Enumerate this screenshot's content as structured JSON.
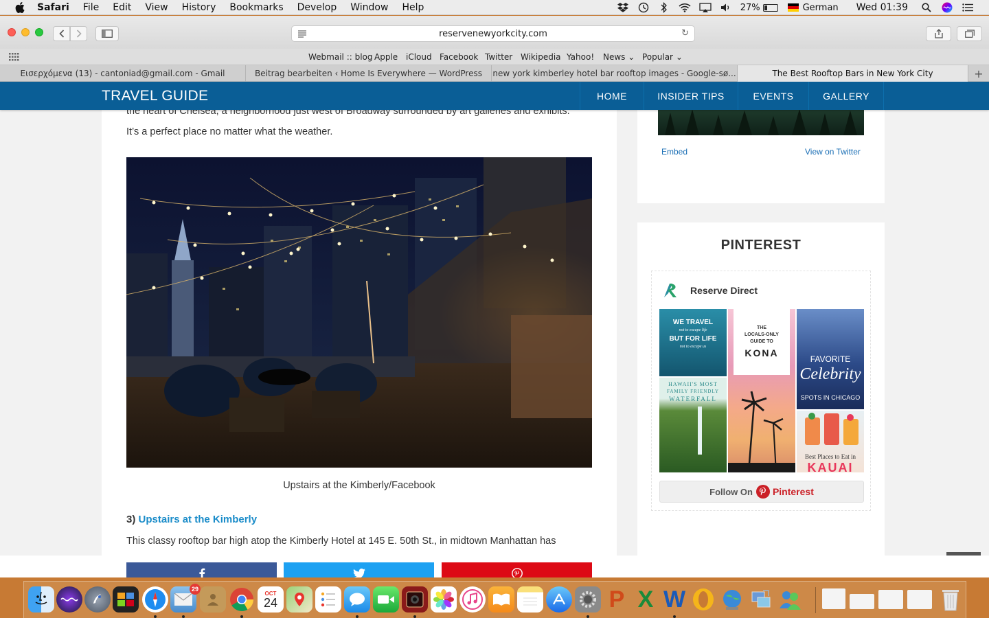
{
  "menubar": {
    "app": "Safari",
    "items": [
      "File",
      "Edit",
      "View",
      "History",
      "Bookmarks",
      "Develop",
      "Window",
      "Help"
    ],
    "battery": "27%",
    "battery_level": 0.27,
    "language": "German",
    "clock": "Wed 01:39"
  },
  "browser": {
    "url": "reservenewyorkcity.com",
    "favorites": [
      "Webmail :: blog",
      "Apple",
      "iCloud",
      "Facebook",
      "Twitter",
      "Wikipedia",
      "Yahoo!",
      "News",
      "Popular"
    ],
    "tabs": [
      "Εισερχόμενα (13) - cantoniad@gmail.com - Gmail",
      "Beitrag bearbeiten ‹ Home Is Everywhere — WordPress",
      "new york kimberley hotel bar rooftop images - Google-sø...",
      "The Best Rooftop Bars in New York City"
    ],
    "active_tab": 3
  },
  "site": {
    "brand": "TRAVEL GUIDE",
    "nav": [
      "HOME",
      "INSIDER TIPS",
      "EVENTS",
      "GALLERY"
    ],
    "article": {
      "para1": "the heart of Chelsea, a neighborhood just west of Broadway surrounded by art galleries and exhibits.",
      "para2": "It’s a perfect place no matter what the weather.",
      "caption": "Upstairs at the Kimberly/Facebook",
      "heading_num": "3)",
      "heading_link": "Upstairs at the Kimberly",
      "next_para": "This classy rooftop bar high atop the Kimberly Hotel at 145 E. 50th St., in midtown Manhattan has"
    },
    "twitter_widget": {
      "embed": "Embed",
      "view": "View on Twitter"
    },
    "pinterest": {
      "title": "PINTEREST",
      "profile_name": "Reserve Direct",
      "pins": {
        "p1_line1": "WE TRAVEL",
        "p1_line2": "not to escape life",
        "p1_line3": "BUT FOR LIFE",
        "p1_line4": "not to escape us",
        "p2_line1": "THE",
        "p2_line2": "LOCALS-ONLY",
        "p2_line3": "GUIDE TO",
        "p2_line4": "KONA",
        "p3_line1": "FAVORITE",
        "p3_line2": "Celebrity",
        "p3_line3": "SPOTS IN CHICAGO",
        "p4_line1": "HAWAII'S MOST",
        "p4_line2": "FAMILY FRIENDLY",
        "p4_line3": "WATERFALL",
        "p6_line1": "Best Places to Eat in",
        "p6_line2": "KAUAI"
      },
      "follow_prefix": "Follow On",
      "follow_brand": "Pinterest"
    },
    "share": {
      "facebook_color": "#3b5998",
      "twitter_color": "#1da1f2",
      "pinterest_color": "#dd0a15"
    }
  },
  "dock": {
    "calendar_month": "OCT",
    "calendar_day": "24",
    "mail_badge": "29"
  }
}
